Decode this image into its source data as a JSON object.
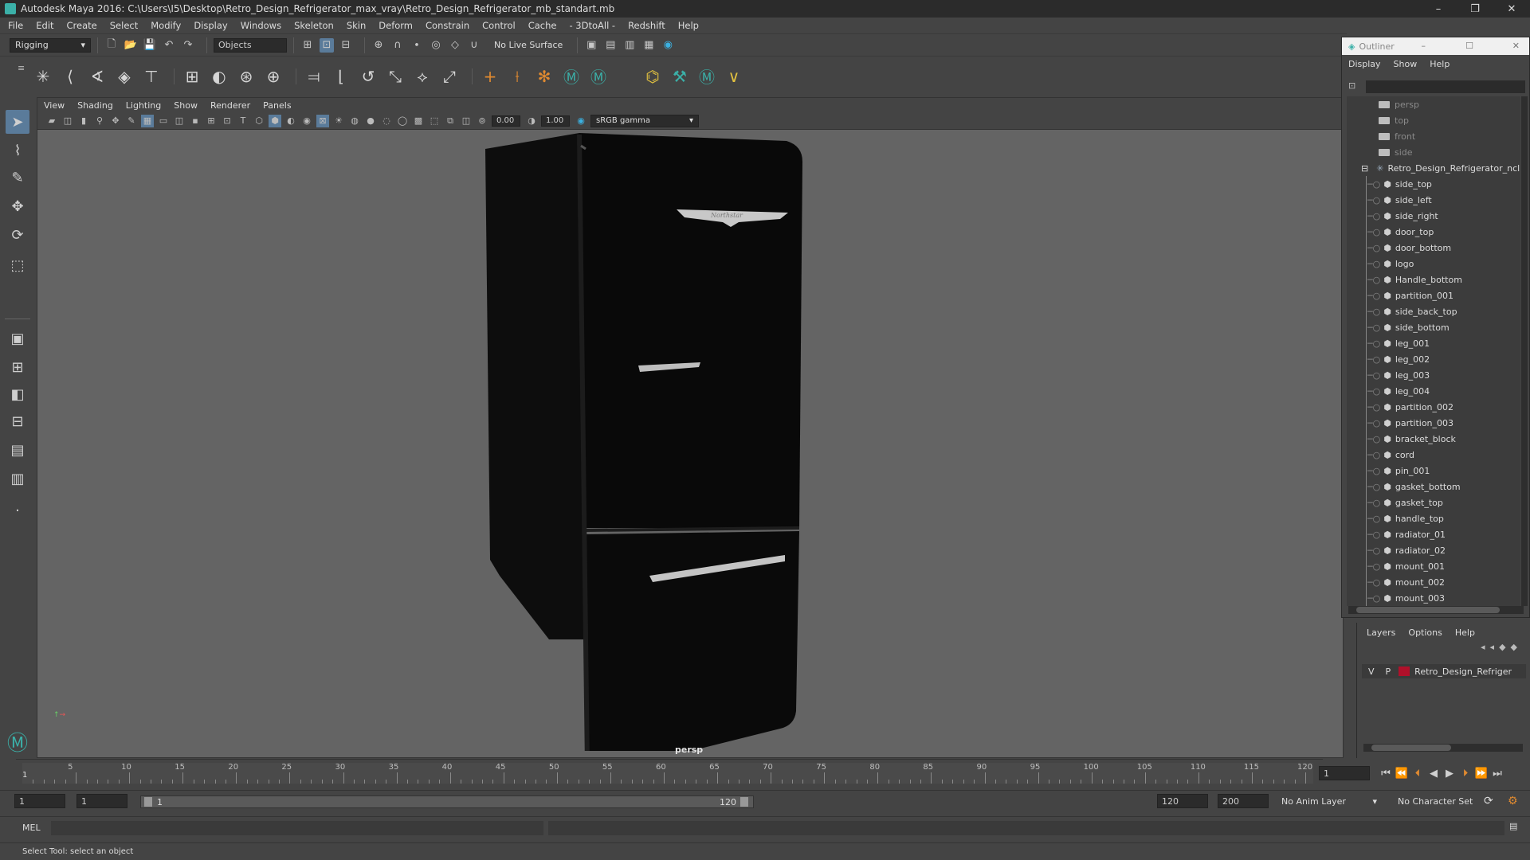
{
  "window": {
    "title": "Autodesk Maya 2016: C:\\Users\\I5\\Desktop\\Retro_Design_Refrigerator_max_vray\\Retro_Design_Refrigerator_mb_standart.mb",
    "minimize": "–",
    "maximize": "❐",
    "close": "✕"
  },
  "menubar": [
    "File",
    "Edit",
    "Create",
    "Select",
    "Modify",
    "Display",
    "Windows",
    "Skeleton",
    "Skin",
    "Deform",
    "Constrain",
    "Control",
    "Cache",
    "- 3DtoAll -",
    "Redshift",
    "Help"
  ],
  "statusline": {
    "menuset": "Rigging",
    "selection_mode": "Objects",
    "live_surface": "No Live Surface"
  },
  "viewport": {
    "menus": [
      "View",
      "Shading",
      "Lighting",
      "Show",
      "Renderer",
      "Panels"
    ],
    "exposure": "0.00",
    "gamma": "1.00",
    "color_space": "sRGB gamma",
    "camera_label": "persp",
    "logo_text": "Northstar"
  },
  "outliner": {
    "title": "Outliner",
    "menus": [
      "Display",
      "Show",
      "Help"
    ],
    "cameras": [
      "persp",
      "top",
      "front",
      "side"
    ],
    "group": "Retro_Design_Refrigerator_ncl",
    "children": [
      "side_top",
      "side_left",
      "side_right",
      "door_top",
      "door_bottom",
      "logo",
      "Handle_bottom",
      "partition_001",
      "side_back_top",
      "side_bottom",
      "leg_001",
      "leg_002",
      "leg_003",
      "leg_004",
      "partition_002",
      "partition_003",
      "bracket_block",
      "cord",
      "pin_001",
      "gasket_bottom",
      "gasket_top",
      "handle_top",
      "radiator_01",
      "radiator_02",
      "mount_001",
      "mount_002",
      "mount_003"
    ]
  },
  "layers": {
    "menus": [
      "Layers",
      "Options",
      "Help"
    ],
    "row": {
      "v": "V",
      "p": "P",
      "name": "Retro_Design_Refriger",
      "color": "#b0102a"
    }
  },
  "timeline": {
    "ticks": [
      5,
      10,
      15,
      20,
      25,
      30,
      35,
      40,
      45,
      50,
      55,
      60,
      65,
      70,
      75,
      80,
      85,
      90,
      95,
      100,
      105,
      110,
      115,
      120
    ],
    "start_label": "1",
    "current_frame": "1"
  },
  "range": {
    "start": "1",
    "playback_start": "1",
    "range_start": "1",
    "range_end_label": "120",
    "playback_end": "120",
    "end": "200",
    "anim_layer": "No Anim Layer",
    "character_set": "No Character Set"
  },
  "commandline": {
    "label": "MEL"
  },
  "help_line": "Select Tool: select an object"
}
